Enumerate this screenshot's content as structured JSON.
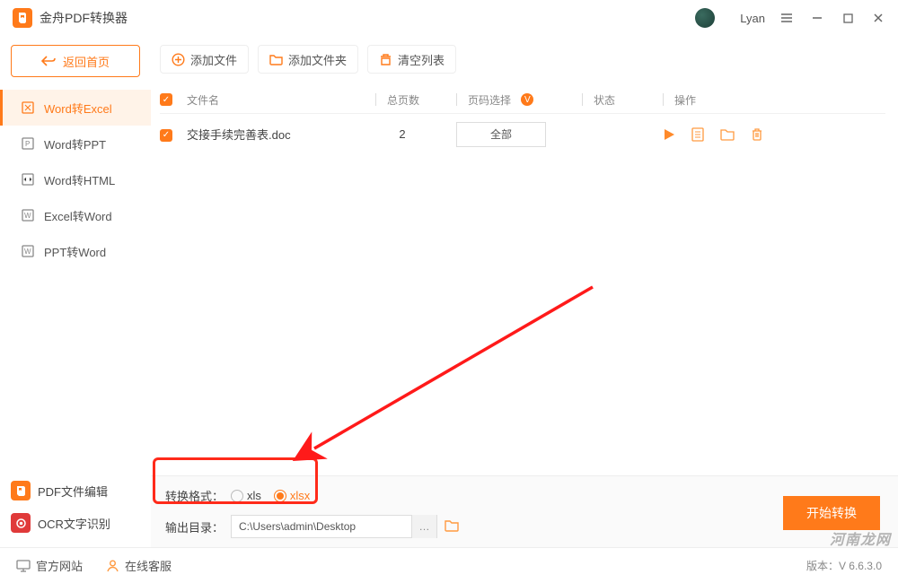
{
  "app": {
    "title": "金舟PDF转换器",
    "user": "Lyan"
  },
  "sidebar": {
    "back": "返回首页",
    "items": [
      {
        "label": "Word转Excel"
      },
      {
        "label": "Word转PPT"
      },
      {
        "label": "Word转HTML"
      },
      {
        "label": "Excel转Word"
      },
      {
        "label": "PPT转Word"
      }
    ]
  },
  "toolbar": {
    "add_file": "添加文件",
    "add_folder": "添加文件夹",
    "clear": "清空列表"
  },
  "table": {
    "head": {
      "name": "文件名",
      "pages": "总页数",
      "range": "页码选择",
      "status": "状态",
      "action": "操作"
    },
    "rows": [
      {
        "name": "交接手续完善表.doc",
        "pages": "2",
        "range": "全部"
      }
    ]
  },
  "quick": {
    "pdf_edit": "PDF文件编辑",
    "ocr": "OCR文字识别"
  },
  "convert": {
    "format_label": "转换格式：",
    "xls": "xls",
    "xlsx": "xlsx",
    "selected": "xlsx",
    "output_label": "输出目录：",
    "output_path": "C:\\Users\\admin\\Desktop",
    "start": "开始转换"
  },
  "footer": {
    "site": "官方网站",
    "support": "在线客服",
    "version": "版本：V 6.6.3.0"
  },
  "watermark": "河南龙网"
}
